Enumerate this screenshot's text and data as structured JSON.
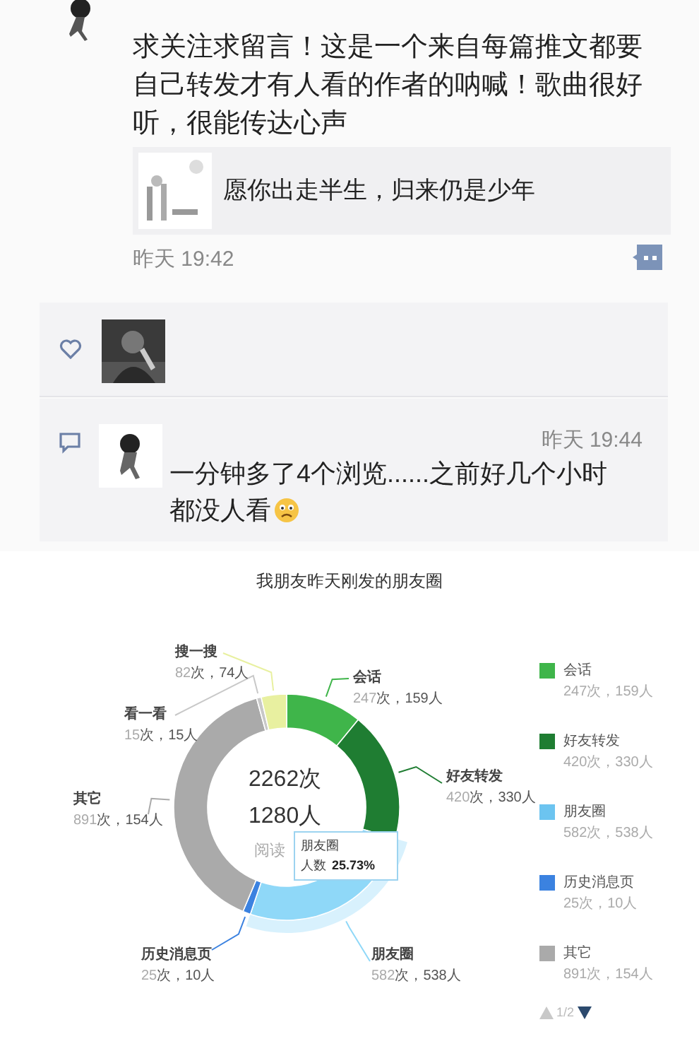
{
  "post": {
    "text": "求关注求留言！这是一个来自每篇推文都要自己转发才有人看的作者的呐喊！歌曲很好听，很能传达心声",
    "link_title": "愿你出走半生，归来仍是少年",
    "time": "昨天 19:42"
  },
  "comment": {
    "time": "昨天 19:44",
    "text_lines": [
      "一分钟多了4个浏览......之前好几个小时",
      "都没人看"
    ]
  },
  "caption": "我朋友昨天刚发的朋友圈",
  "chart": {
    "center_total": "2262次",
    "center_people": "1280人",
    "center_label": "阅读",
    "tooltip": {
      "title": "朋友圈",
      "label": "人数",
      "value": "25.73%"
    },
    "slice_labels": [
      {
        "stats_suffix": "次，159人",
        "color": "#3fb54a",
        "highlighted": false
      },
      {
        "stats_suffix": "次，330人",
        "color": "#1f7d32",
        "highlighted": false
      },
      {
        "stats_suffix": "次，538人",
        "color": "#8fd8f8",
        "highlighted": true
      },
      {
        "stats_suffix": "次，10人",
        "color": "#3b82e0",
        "highlighted": false
      },
      {
        "stats_suffix": "次，154人",
        "color": "#aaaaaa",
        "highlighted": false
      },
      {
        "stats_suffix": "次，15人",
        "color": "#c8c8c8",
        "highlighted": false
      },
      {
        "stats_suffix": "次，74人",
        "color": "#e8f0a0",
        "highlighted": false
      }
    ],
    "chart_data": {
      "type": "donut",
      "categories": [
        "会话",
        "好友转发",
        "朋友圈",
        "历史消息页",
        "其它",
        "看一看",
        "搜一搜"
      ],
      "series": [
        {
          "values": [
            247,
            420,
            582,
            25,
            891,
            15,
            82
          ]
        }
      ],
      "data_labels": true
    },
    "legend": {
      "items": [
        {
          "name": "会话",
          "stats": "247次，159人",
          "color": "#3fb54a"
        },
        {
          "name": "好友转发",
          "stats": "420次，330人",
          "color": "#1f7d32"
        },
        {
          "name": "朋友圈",
          "stats": "582次，538人",
          "color": "#6cc4f0"
        },
        {
          "name": "历史消息页",
          "stats": "25次，10人",
          "color": "#3b82e0"
        },
        {
          "name": "其它",
          "stats": "891次，154人",
          "color": "#aaaaaa"
        }
      ],
      "page": "1/2"
    }
  }
}
